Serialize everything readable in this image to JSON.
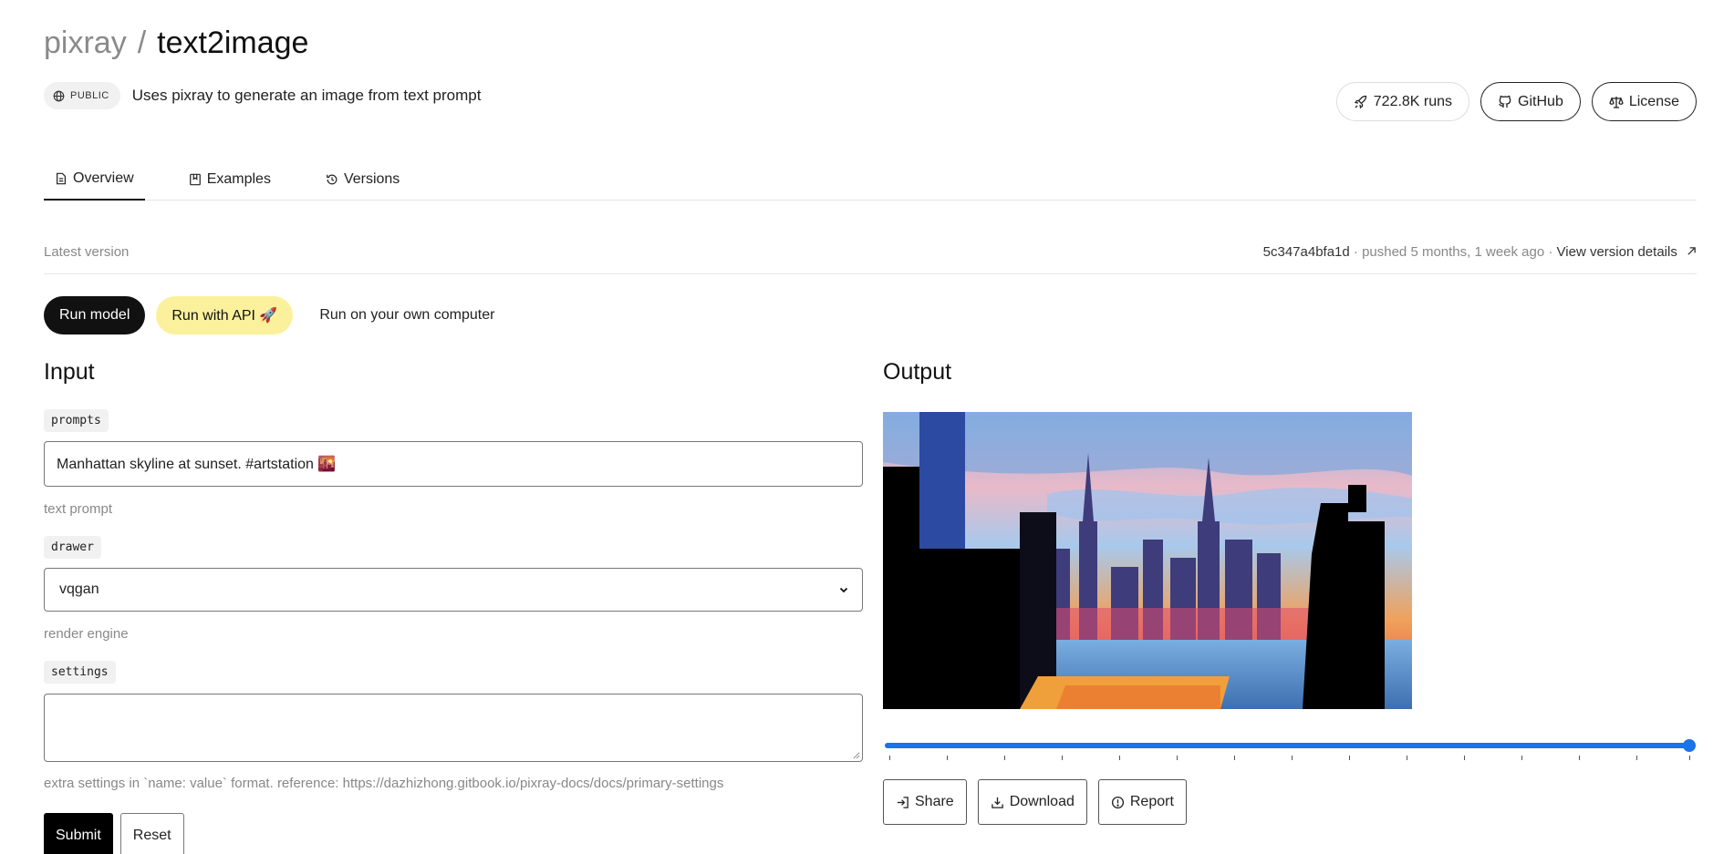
{
  "header": {
    "owner": "pixray",
    "separator": "/",
    "repo": "text2image",
    "badge_label": "PUBLIC",
    "description": "Uses pixray to generate an image from text prompt",
    "runs_label": "722.8K runs",
    "github_label": "GitHub",
    "license_label": "License"
  },
  "tabs": [
    {
      "label": "Overview",
      "icon": "document-icon",
      "active": true
    },
    {
      "label": "Examples",
      "icon": "bookmark-icon",
      "active": false
    },
    {
      "label": "Versions",
      "icon": "history-icon",
      "active": false
    }
  ],
  "version_bar": {
    "latest_label": "Latest version",
    "version_id": "5c347a4bfa1d",
    "pushed_text": " · pushed 5 months, 1 week ago · ",
    "details_link": "View version details"
  },
  "run_options": {
    "run_model": "Run model",
    "run_api": "Run with API 🚀",
    "run_local": "Run on your own computer"
  },
  "input": {
    "title": "Input",
    "prompts": {
      "label": "prompts",
      "value": "Manhattan skyline at sunset. #artstation 🌇",
      "hint": "text prompt"
    },
    "drawer": {
      "label": "drawer",
      "value": "vqgan",
      "hint": "render engine"
    },
    "settings": {
      "label": "settings",
      "value": "",
      "hint": "extra settings in `name: value` format. reference: https://dazhizhong.gitbook.io/pixray-docs/docs/primary-settings"
    },
    "submit_label": "Submit",
    "reset_label": "Reset"
  },
  "output": {
    "title": "Output",
    "slider_progress": 1.0,
    "share_label": "Share",
    "download_label": "Download",
    "report_label": "Report"
  },
  "colors": {
    "accent_blue": "#1a73e8",
    "api_yellow": "#fbf19c",
    "dark": "#111111"
  }
}
